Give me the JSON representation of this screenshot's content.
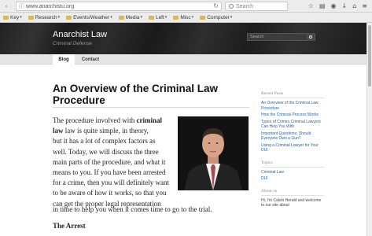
{
  "browser": {
    "url": "www.anarchistu.org",
    "search_placeholder": "Search",
    "bookmarks": [
      "Key",
      "Research",
      "Events/Weather",
      "Media",
      "Left",
      "Misc",
      "Computer"
    ]
  },
  "site": {
    "title": "Anarchist Law",
    "description": "Criminal Defense",
    "search_placeholder": "Search"
  },
  "nav": {
    "tabs": [
      "Blog",
      "Contact"
    ],
    "active": "Blog"
  },
  "post": {
    "title": "An Overview of the Criminal Law Procedure",
    "para_lines": [
      "The procedure involved with",
      "law is quite simple, in theory,",
      "but it has a lot of complex factors as",
      "well.  Today, we will discuss the three",
      "main parts of the procedure, and what it",
      "means to you.  If you have been arrested",
      "for a crime, then you will definitely want",
      "to be aware of how it works, so that you",
      "can get the proper legal representation"
    ],
    "bold_phrase_a": "criminal",
    "bold_phrase_b": "law",
    "para_tail": "in time to help you when it comes time to go to the trial.",
    "subhead": "The Arrest"
  },
  "sidebar": {
    "recent_heading": "Recent Posts",
    "recent_posts": [
      "An Overview of the Criminal Law Procedure",
      "How the Criminal Process Works",
      "Types of Crimes Criminal Lawyers Can Help You With",
      "Important Questions: Should Everyone Own a Gun?",
      "Using a Criminal Lawyer for Your DUI"
    ],
    "topics_heading": "Topics",
    "topics": [
      "Criminal Law",
      "DUI"
    ],
    "about_heading": "About us",
    "about_text": "Hi, I'm Calvin Herald and welcome to our site about"
  }
}
